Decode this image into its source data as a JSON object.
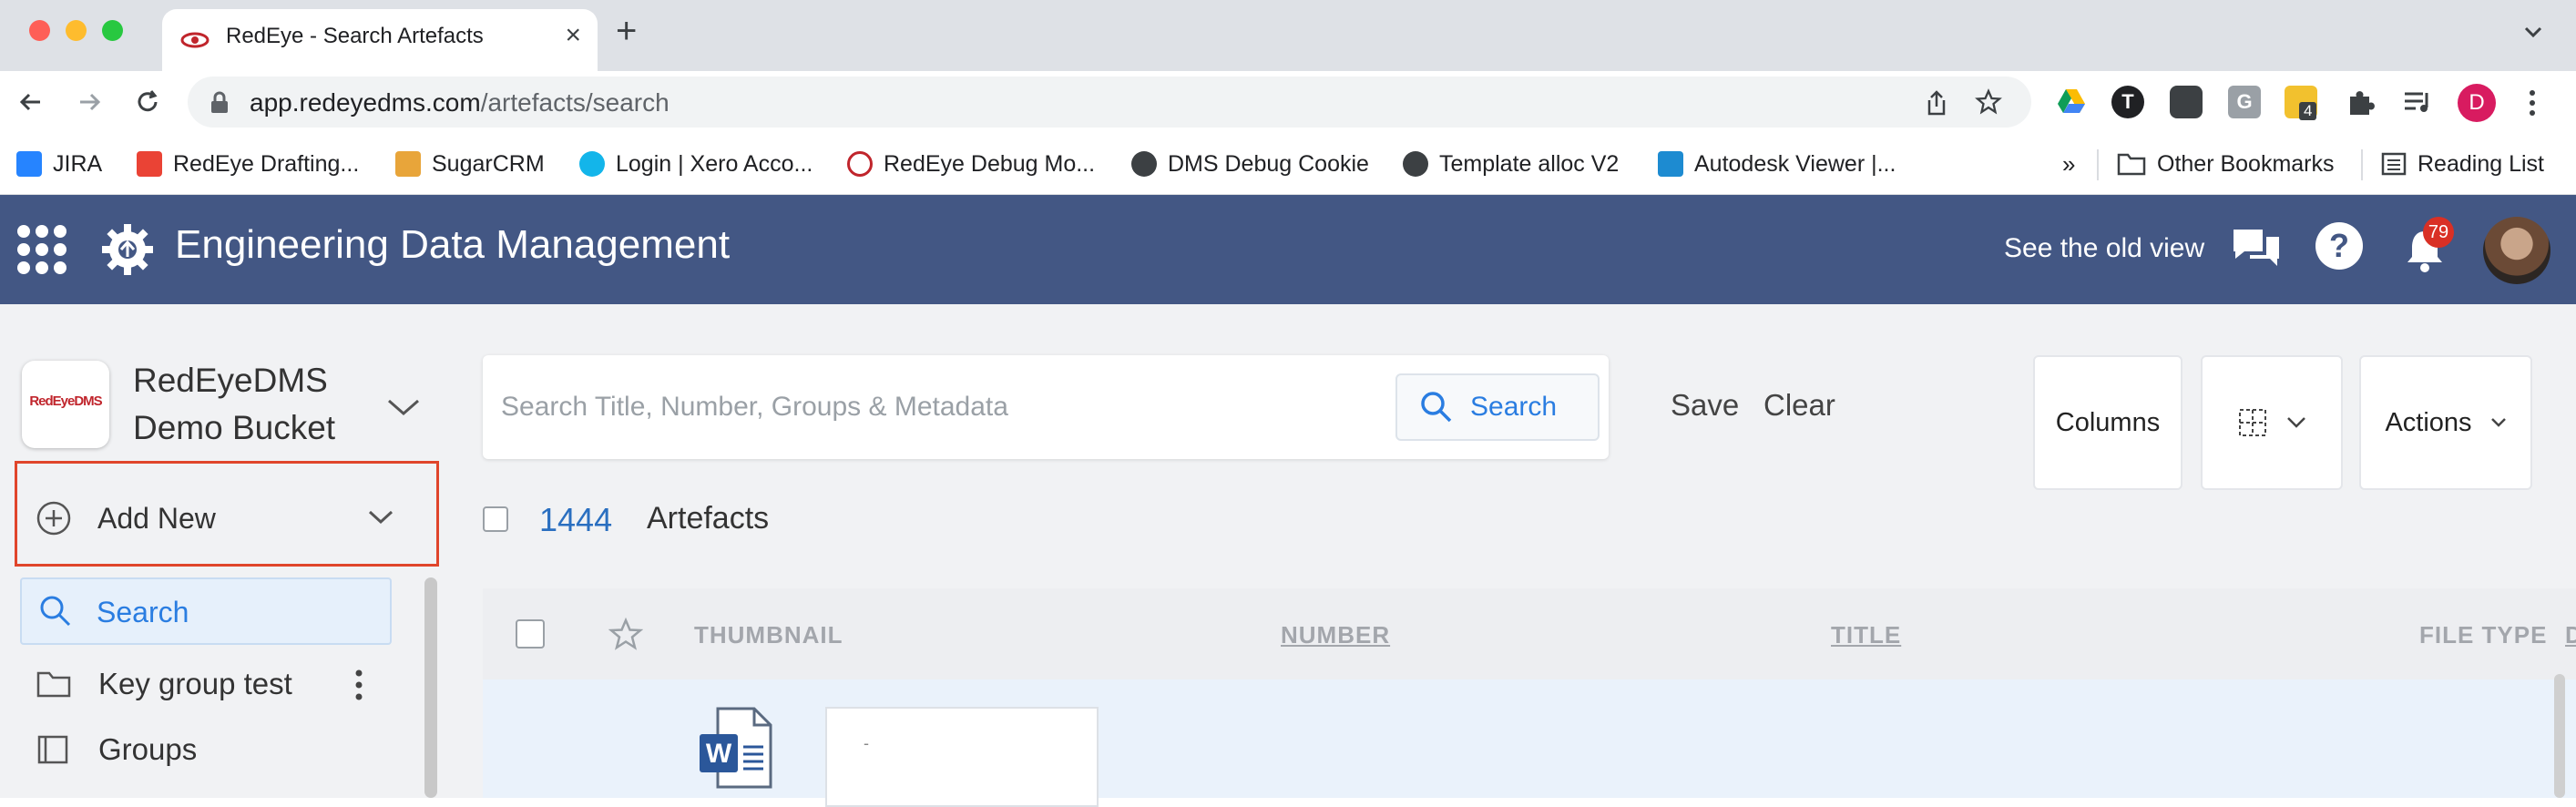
{
  "browser": {
    "tab_title": "RedEye - Search Artefacts",
    "url_domain": "app.redeyedms.com",
    "url_path": "/artefacts/search",
    "profile_initial": "D",
    "extension_badge": "4",
    "bookmarks": [
      {
        "label": "JIRA",
        "color": "#2684ff"
      },
      {
        "label": "RedEye Drafting...",
        "color": "#ea4335"
      },
      {
        "label": "SugarCRM",
        "color": "#e8a53a"
      },
      {
        "label": "Login | Xero Acco...",
        "color": "#13b5ea"
      },
      {
        "label": "RedEye Debug Mo...",
        "color": "#c0252c"
      },
      {
        "label": "DMS Debug Cookie",
        "color": "#3c4043"
      },
      {
        "label": "Template alloc V2",
        "color": "#3c4043"
      },
      {
        "label": "Autodesk Viewer |...",
        "color": "#1d8bd1"
      }
    ],
    "bookmarks_overflow": "»",
    "other_bookmarks": "Other Bookmarks",
    "reading_list": "Reading List"
  },
  "app": {
    "title": "Engineering Data Management",
    "old_view": "See the old view",
    "notification_count": "79",
    "header_color": "#435784"
  },
  "sidebar": {
    "logo_text": "RedEyeDMS",
    "bucket_name": "RedEyeDMS Demo Bucket",
    "add_new": "Add New",
    "search": "Search",
    "items": [
      {
        "label": "Key group test"
      },
      {
        "label": "Groups"
      }
    ]
  },
  "search": {
    "placeholder": "Search Title, Number, Groups & Metadata",
    "button": "Search",
    "save": "Save",
    "clear": "Clear"
  },
  "toolbar": {
    "columns": "Columns",
    "actions": "Actions"
  },
  "results": {
    "count": "1444",
    "label": "Artefacts"
  },
  "table": {
    "headers": {
      "thumbnail": "THUMBNAIL",
      "number": "NUMBER",
      "title": "TITLE",
      "file_type": "FILE TYPE",
      "next": "D"
    },
    "row1": {
      "file_icon": "word-file-icon",
      "thumb_mark": "-"
    }
  }
}
